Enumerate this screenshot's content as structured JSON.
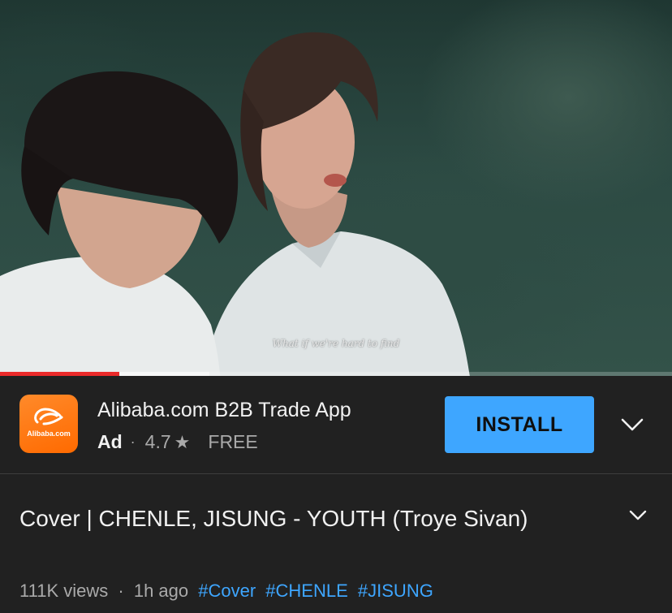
{
  "player": {
    "subtitle": "What if we're hard to find",
    "progress_played": 0.177,
    "progress_buffered": 0.311,
    "played_color": "#ea2a2a"
  },
  "ad": {
    "logo_icon": "alibaba-logo-icon",
    "logo_text": "Alibaba.com",
    "title": "Alibaba.com B2B Trade App",
    "badge": "Ad",
    "dot": "·",
    "rating": "4.7",
    "star_icon": "star-icon",
    "star": "★",
    "price": "FREE",
    "install_label": "INSTALL",
    "install_color": "#3ea6ff",
    "menu_icon": "chevron-down-icon"
  },
  "video": {
    "title": "Cover | CHENLE, JISUNG - YOUTH (Troye Sivan)",
    "expand_icon": "chevron-down-icon",
    "views": "111K views",
    "separator": "·",
    "age": "1h ago",
    "hashtags": [
      "#Cover",
      "#CHENLE",
      "#JISUNG"
    ]
  }
}
